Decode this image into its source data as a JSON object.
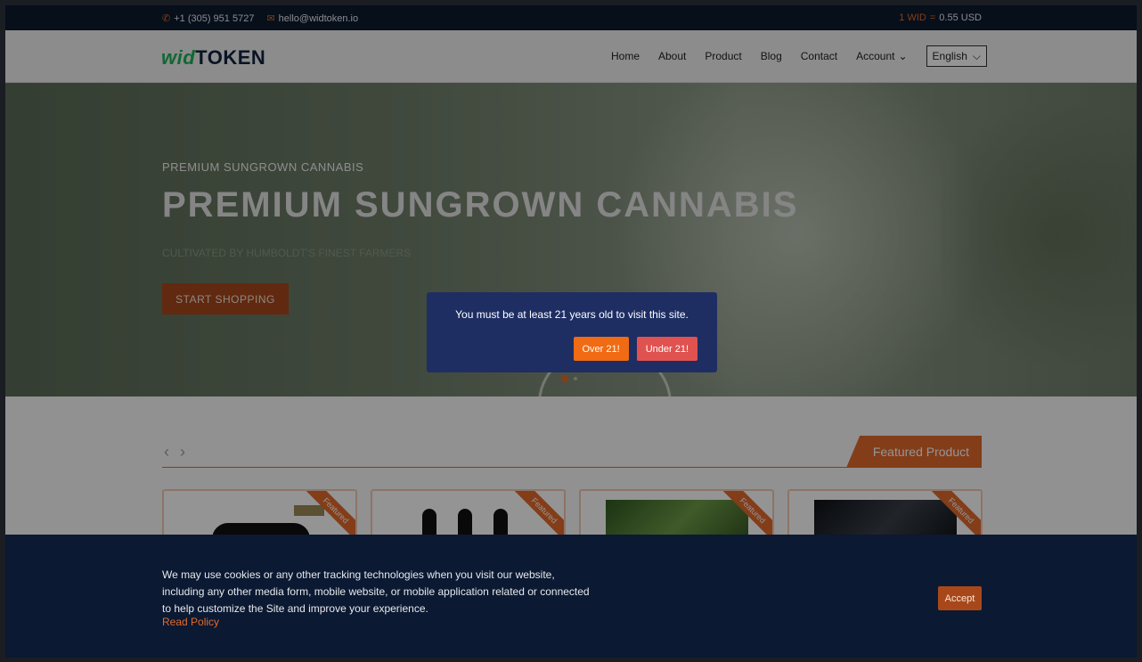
{
  "topbar": {
    "phone": "+1 (305) 951 5727",
    "email": "hello@widtoken.io",
    "rate_token": "1 WID",
    "rate_equals": "=",
    "rate_value": "0.55 USD",
    "phone_icon": "phone-icon",
    "email_icon": "envelope-icon"
  },
  "header": {
    "logo_part1": "wid",
    "logo_part2": "TOKEN",
    "nav": [
      "Home",
      "About",
      "Product",
      "Blog",
      "Contact"
    ],
    "account": "Account",
    "language": "English"
  },
  "hero": {
    "subtitle": "PREMIUM SUNGROWN CANNABIS",
    "title": "PREMIUM SUNGROWN CANNABIS",
    "tagline": "CULTIVATED BY HUMBOLDT'S FINEST FARMERS",
    "cta": "START SHOPPING"
  },
  "featured": {
    "tab_label": "Featured Product",
    "ribbon": "Featured",
    "prev": "‹",
    "next": "›"
  },
  "age_modal": {
    "message": "You must be at least 21 years old to visit this site.",
    "over": "Over 21!",
    "under": "Under 21!"
  },
  "cookie": {
    "line1": "We may use cookies or any other tracking technologies when you visit our website,",
    "line2": "including any other media form, mobile website, or mobile application related or connected",
    "line3": "to help customize the Site and improve your experience.",
    "policy": "Read Policy",
    "accept": "Accept"
  },
  "colors": {
    "accent": "#e26a2c",
    "navy": "#0d1a30",
    "modal": "#1e2e63",
    "brand_green": "#1eb15a"
  }
}
